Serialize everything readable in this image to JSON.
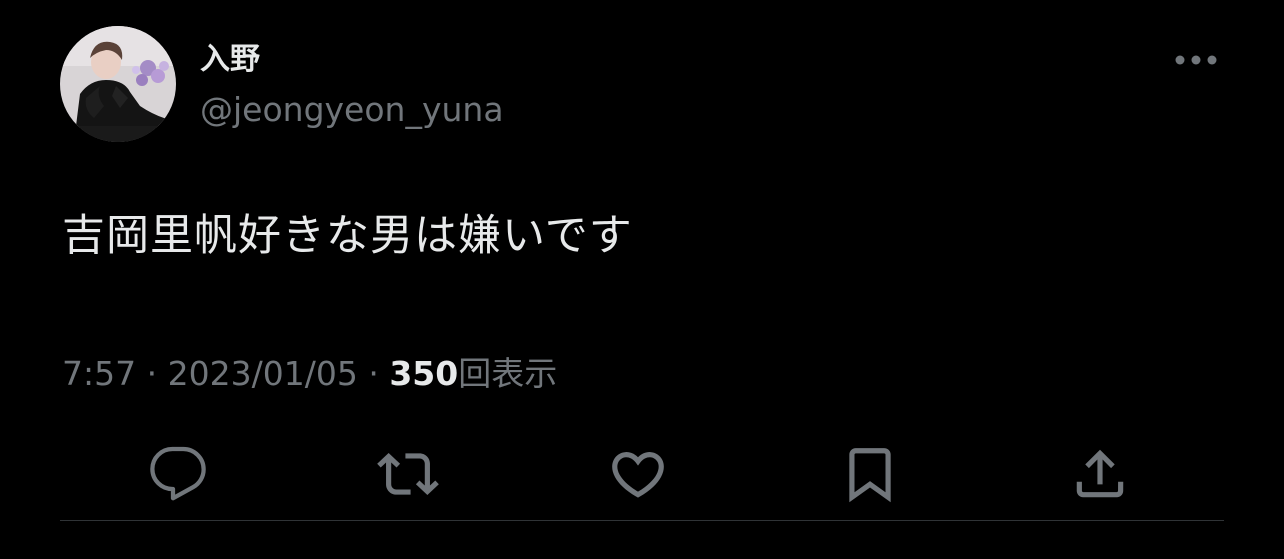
{
  "colors": {
    "background": "#000000",
    "primary_text": "#e7e9ea",
    "secondary_text": "#71767b",
    "divider": "#2f3336"
  },
  "author": {
    "display_name": "入野",
    "handle": "@jeongyeon_yuna",
    "avatar_icon": "profile-photo"
  },
  "tweet": {
    "text": "吉岡里帆好きな男は嫌いです"
  },
  "meta": {
    "time": "7:57",
    "separator": "·",
    "date": "2023/01/05",
    "views_count": "350",
    "views_label": "回表示"
  },
  "actions": [
    {
      "name": "reply",
      "icon": "speech-bubble-icon"
    },
    {
      "name": "retweet",
      "icon": "retweet-arrows-icon"
    },
    {
      "name": "like",
      "icon": "heart-icon"
    },
    {
      "name": "bookmark",
      "icon": "bookmark-icon"
    },
    {
      "name": "share",
      "icon": "share-upload-icon"
    }
  ],
  "more_icon": "more-dots-icon"
}
